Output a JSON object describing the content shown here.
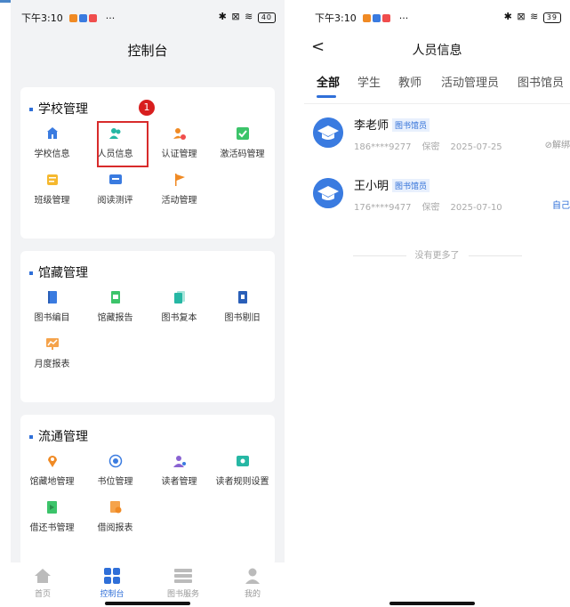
{
  "colors": {
    "accent": "#2f6fd8",
    "highlight": "#d82b2b"
  },
  "left": {
    "status": {
      "time": "下午3:10",
      "dots": "···",
      "battery": "40"
    },
    "title": "控制台",
    "step_badge": "1",
    "sections": [
      {
        "title": "学校管理",
        "items": [
          {
            "label": "学校信息",
            "icon": "school-icon"
          },
          {
            "label": "人员信息",
            "icon": "people-icon"
          },
          {
            "label": "认证管理",
            "icon": "certify-icon"
          },
          {
            "label": "激活码管理",
            "icon": "checkbox-icon"
          },
          {
            "label": "班级管理",
            "icon": "class-icon"
          },
          {
            "label": "阅读测评",
            "icon": "assessment-icon"
          },
          {
            "label": "活动管理",
            "icon": "flag-icon"
          }
        ]
      },
      {
        "title": "馆藏管理",
        "items": [
          {
            "label": "图书编目",
            "icon": "book-icon"
          },
          {
            "label": "馆藏报告",
            "icon": "report-icon"
          },
          {
            "label": "图书复本",
            "icon": "copy-icon"
          },
          {
            "label": "图书剔旧",
            "icon": "discard-icon"
          },
          {
            "label": "月度报表",
            "icon": "chart-icon"
          }
        ]
      },
      {
        "title": "流通管理",
        "items": [
          {
            "label": "馆藏地管理",
            "icon": "location-icon"
          },
          {
            "label": "书位管理",
            "icon": "target-icon"
          },
          {
            "label": "读者管理",
            "icon": "reader-icon"
          },
          {
            "label": "读者规则设置",
            "icon": "rule-icon"
          },
          {
            "label": "借还书管理",
            "icon": "borrow-icon"
          },
          {
            "label": "借阅报表",
            "icon": "borrow-report-icon"
          }
        ]
      }
    ],
    "tabbar": [
      {
        "label": "首页",
        "icon": "home-icon"
      },
      {
        "label": "控制台",
        "icon": "dashboard-icon"
      },
      {
        "label": "图书服务",
        "icon": "books-icon"
      },
      {
        "label": "我的",
        "icon": "profile-icon"
      }
    ]
  },
  "right": {
    "status": {
      "time": "下午3:10",
      "dots": "···",
      "battery": "39"
    },
    "back": "<",
    "title": "人员信息",
    "tabs": [
      "全部",
      "学生",
      "教师",
      "活动管理员",
      "图书馆员"
    ],
    "people": [
      {
        "name": "李老师",
        "role": "图书馆员",
        "phone": "186****9277",
        "privacy": "保密",
        "date": "2025-07-25",
        "action": "解绑"
      },
      {
        "name": "王小明",
        "role": "图书馆员",
        "phone": "176****9477",
        "privacy": "保密",
        "date": "2025-07-10",
        "action": "自己"
      }
    ],
    "footer": "没有更多了"
  }
}
